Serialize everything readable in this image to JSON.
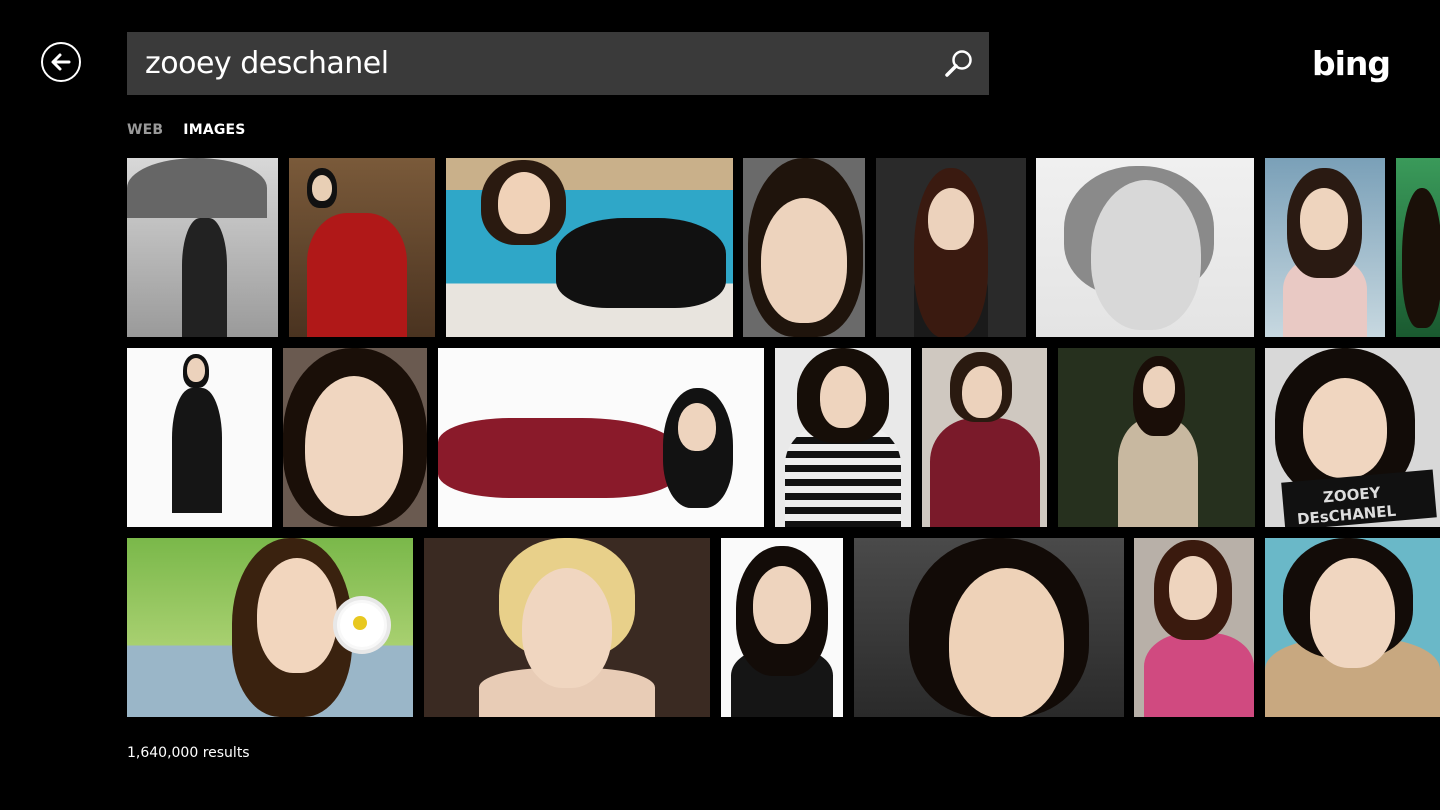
{
  "search": {
    "query": "zooey deschanel",
    "placeholder": ""
  },
  "logo": {
    "text": "bing"
  },
  "tabs": [
    {
      "label": "WEB",
      "active": false
    },
    {
      "label": "IMAGES",
      "active": true
    }
  ],
  "results": {
    "count_text": "1,640,000 results"
  },
  "icons": {
    "back": "back-arrow-icon",
    "search": "search-icon"
  },
  "colors": {
    "background": "#000000",
    "search_box": "#3a3a3a",
    "tab_inactive": "#9a9a9a",
    "text": "#ffffff"
  }
}
